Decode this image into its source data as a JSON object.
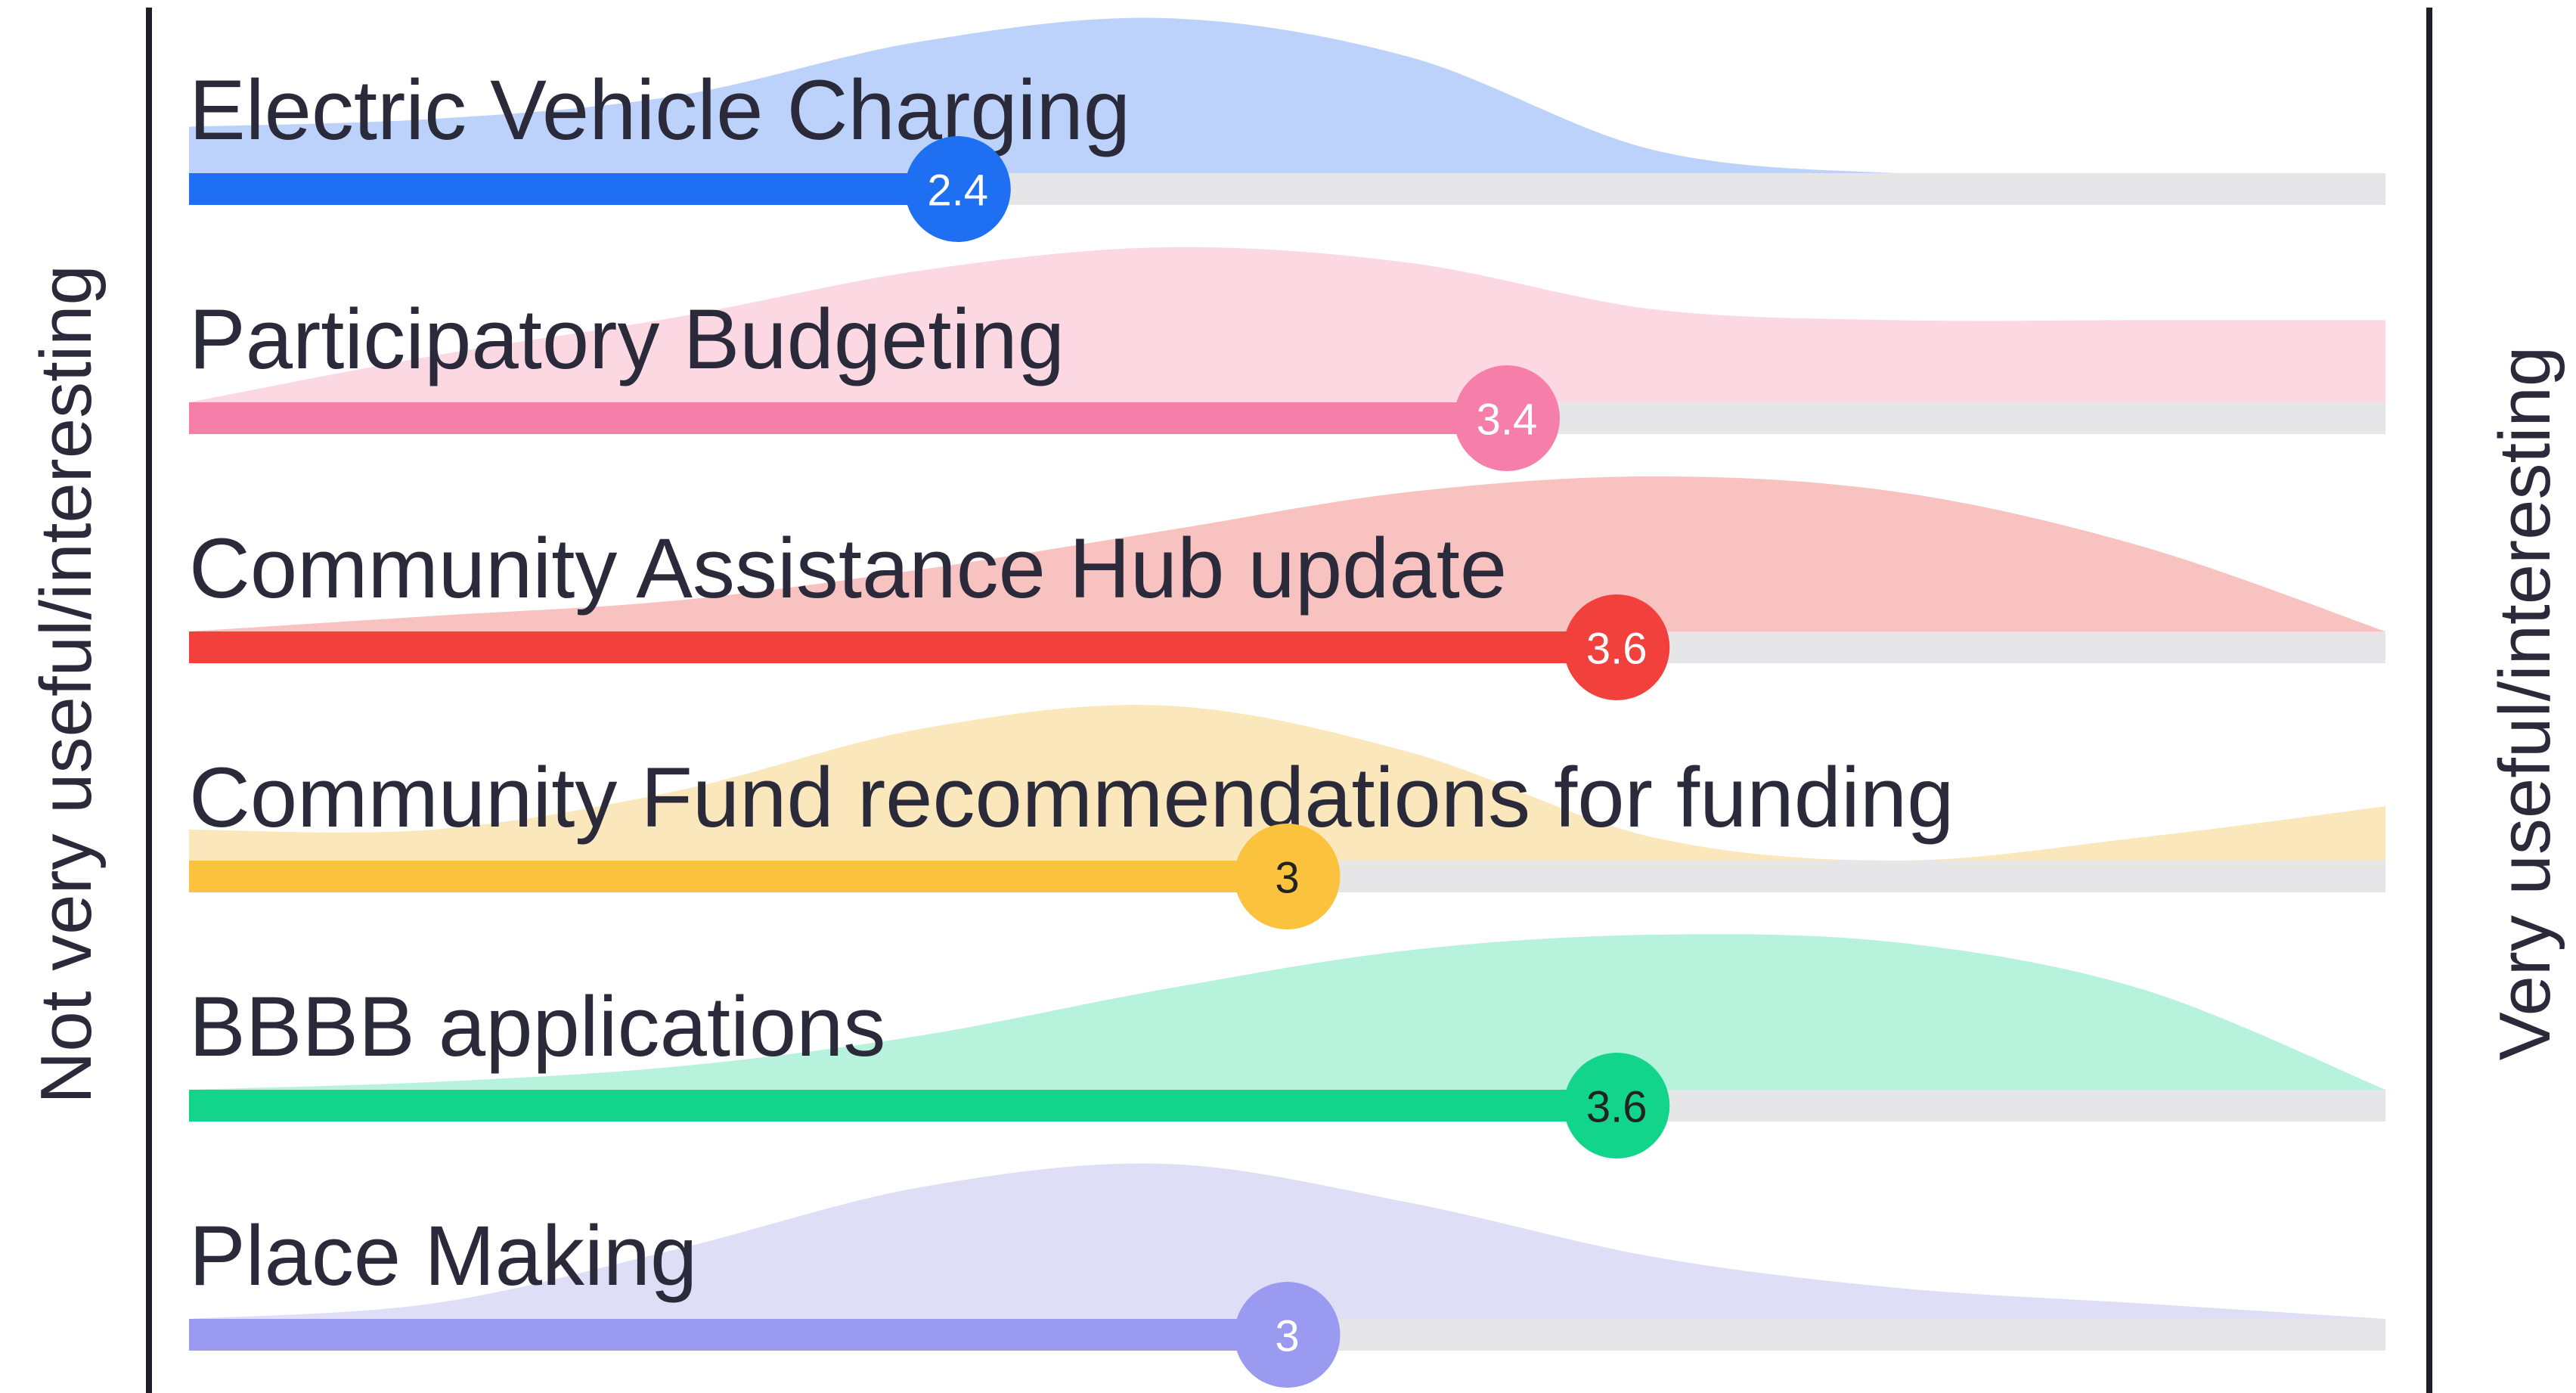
{
  "chart_data": {
    "type": "area",
    "left_label": "Not very useful/interesting",
    "right_label": "Very useful/interesting",
    "scale": [
      1,
      5
    ],
    "grid": false,
    "series": [
      {
        "name": "Electric Vehicle Charging",
        "value": 2.4,
        "value_label": "2.4",
        "color": "#1f6ff2",
        "fill": "#b9d0fb",
        "text_color": "#ffffff",
        "density": [
          0.3,
          0.35,
          0.5,
          0.85,
          1.0,
          0.75,
          0.15,
          0.0,
          0.0,
          0.0
        ]
      },
      {
        "name": "Participatory Budgeting",
        "value": 3.4,
        "value_label": "3.4",
        "color": "#f57fa8",
        "fill": "#fcd6e2",
        "text_color": "#ffffff",
        "density": [
          0.0,
          0.3,
          0.55,
          0.85,
          1.0,
          0.9,
          0.6,
          0.53,
          0.53,
          0.53
        ]
      },
      {
        "name": "Community Assistance Hub update",
        "value": 3.6,
        "value_label": "3.6",
        "color": "#f2403c",
        "fill": "#f8bfbd",
        "text_color": "#ffffff",
        "density": [
          0.0,
          0.1,
          0.2,
          0.4,
          0.65,
          0.9,
          1.0,
          0.9,
          0.55,
          0.0
        ]
      },
      {
        "name": "Community Fund recommendations for funding",
        "value": 3.0,
        "value_label": "3",
        "color": "#fbc23d",
        "fill": "#fbe6b8",
        "text_color": "#222222",
        "density": [
          0.2,
          0.2,
          0.45,
          0.85,
          1.0,
          0.7,
          0.15,
          0.0,
          0.15,
          0.35
        ]
      },
      {
        "name": "BBBB applications",
        "value": 3.6,
        "value_label": "3.6",
        "color": "#12d48a",
        "fill": "#b3f1da",
        "text_color": "#222222",
        "density": [
          0.0,
          0.05,
          0.15,
          0.35,
          0.65,
          0.9,
          1.0,
          0.95,
          0.65,
          0.0
        ]
      },
      {
        "name": "Place Making",
        "value": 3.0,
        "value_label": "3",
        "color": "#9a9af0",
        "fill": "#dcdcf7",
        "text_color": "#ffffff",
        "density": [
          0.0,
          0.1,
          0.45,
          0.85,
          1.0,
          0.75,
          0.4,
          0.2,
          0.1,
          0.0
        ]
      }
    ]
  }
}
